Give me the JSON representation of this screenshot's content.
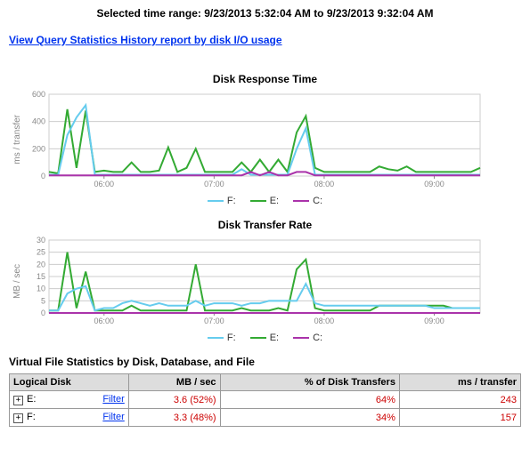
{
  "header": {
    "range": "Selected time range: 9/23/2013 5:32:04 AM to 9/23/2013 9:32:04 AM",
    "history_link": "View Query Statistics History report by disk I/O usage"
  },
  "legend": {
    "items": [
      {
        "label": "F:",
        "color": "#66ccee"
      },
      {
        "label": "E:",
        "color": "#33aa33"
      },
      {
        "label": "C:",
        "color": "#aa33aa"
      }
    ]
  },
  "table": {
    "title": "Virtual File Statistics by Disk, Database, and File",
    "headers": [
      "Logical Disk",
      "MB / sec",
      "% of Disk Transfers",
      "ms / transfer"
    ],
    "filter_label": "Filter",
    "rows": [
      {
        "disk": "E:",
        "mb": "3.6 (52%)",
        "pct": "64%",
        "ms": "243"
      },
      {
        "disk": "F:",
        "mb": "3.3 (48%)",
        "pct": "34%",
        "ms": "157"
      }
    ]
  },
  "chart_data": [
    {
      "type": "line",
      "title": "Disk Response Time",
      "ylabel": "ms / transfer",
      "ylim": [
        0,
        600
      ],
      "yticks": [
        0,
        200,
        400,
        600
      ],
      "x": [
        0,
        1,
        2,
        3,
        4,
        5,
        6,
        7,
        8,
        9,
        10,
        11,
        12,
        13,
        14,
        15,
        16,
        17,
        18,
        19,
        20,
        21,
        22,
        23,
        24,
        25,
        26,
        27,
        28,
        29,
        30,
        31,
        32,
        33,
        34,
        35,
        36,
        37,
        38,
        39,
        40,
        41,
        42,
        43,
        44,
        45,
        46,
        47
      ],
      "xtick_labels": {
        "6": "06:00",
        "18": "07:00",
        "30": "08:00",
        "42": "09:00"
      },
      "series": [
        {
          "name": "E:",
          "color": "#33aa33",
          "values": [
            30,
            20,
            490,
            60,
            480,
            30,
            40,
            30,
            30,
            100,
            30,
            30,
            40,
            210,
            30,
            60,
            200,
            30,
            30,
            30,
            30,
            100,
            30,
            120,
            30,
            120,
            30,
            320,
            440,
            60,
            30,
            30,
            30,
            30,
            30,
            30,
            70,
            50,
            40,
            70,
            30,
            30,
            30,
            30,
            30,
            30,
            30,
            60
          ]
        },
        {
          "name": "F:",
          "color": "#66ccee",
          "values": [
            10,
            10,
            300,
            430,
            520,
            10,
            10,
            10,
            10,
            10,
            10,
            10,
            10,
            10,
            10,
            10,
            10,
            10,
            10,
            10,
            10,
            50,
            10,
            10,
            10,
            10,
            10,
            200,
            350,
            10,
            10,
            10,
            10,
            10,
            10,
            10,
            10,
            10,
            10,
            10,
            10,
            10,
            10,
            10,
            10,
            10,
            10,
            10
          ]
        },
        {
          "name": "C:",
          "color": "#aa33aa",
          "values": [
            5,
            5,
            5,
            5,
            5,
            5,
            5,
            5,
            5,
            5,
            5,
            5,
            5,
            5,
            5,
            5,
            5,
            5,
            5,
            5,
            5,
            5,
            30,
            5,
            30,
            5,
            5,
            30,
            30,
            5,
            5,
            5,
            5,
            5,
            5,
            5,
            5,
            5,
            5,
            5,
            5,
            5,
            5,
            5,
            5,
            5,
            5,
            5
          ]
        }
      ]
    },
    {
      "type": "line",
      "title": "Disk Transfer Rate",
      "ylabel": "MB / sec",
      "ylim": [
        0,
        30
      ],
      "yticks": [
        0,
        5,
        10,
        15,
        20,
        25,
        30
      ],
      "x": [
        0,
        1,
        2,
        3,
        4,
        5,
        6,
        7,
        8,
        9,
        10,
        11,
        12,
        13,
        14,
        15,
        16,
        17,
        18,
        19,
        20,
        21,
        22,
        23,
        24,
        25,
        26,
        27,
        28,
        29,
        30,
        31,
        32,
        33,
        34,
        35,
        36,
        37,
        38,
        39,
        40,
        41,
        42,
        43,
        44,
        45,
        46,
        47
      ],
      "xtick_labels": {
        "6": "06:00",
        "18": "07:00",
        "30": "08:00",
        "42": "09:00"
      },
      "series": [
        {
          "name": "E:",
          "color": "#33aa33",
          "values": [
            1,
            1,
            25,
            2,
            17,
            1,
            1,
            1,
            1,
            3,
            1,
            1,
            1,
            1,
            1,
            1,
            20,
            1,
            1,
            1,
            1,
            2,
            1,
            1,
            1,
            2,
            1,
            18,
            22,
            2,
            1,
            1,
            1,
            1,
            1,
            1,
            3,
            3,
            3,
            3,
            3,
            3,
            3,
            3,
            2,
            2,
            2,
            2
          ]
        },
        {
          "name": "F:",
          "color": "#66ccee",
          "values": [
            1,
            1,
            8,
            10,
            11,
            1,
            2,
            2,
            4,
            5,
            4,
            3,
            4,
            3,
            3,
            3,
            5,
            3,
            4,
            4,
            4,
            3,
            4,
            4,
            5,
            5,
            5,
            5,
            12,
            4,
            3,
            3,
            3,
            3,
            3,
            3,
            3,
            3,
            3,
            3,
            3,
            3,
            2,
            2,
            2,
            2,
            2,
            2
          ]
        },
        {
          "name": "C:",
          "color": "#aa33aa",
          "values": [
            0,
            0,
            0,
            0,
            0,
            0,
            0,
            0,
            0,
            0,
            0,
            0,
            0,
            0,
            0,
            0,
            0,
            0,
            0,
            0,
            0,
            0,
            0,
            0,
            0,
            0,
            0,
            0,
            0,
            0,
            0,
            0,
            0,
            0,
            0,
            0,
            0,
            0,
            0,
            0,
            0,
            0,
            0,
            0,
            0,
            0,
            0,
            0
          ]
        }
      ]
    }
  ]
}
